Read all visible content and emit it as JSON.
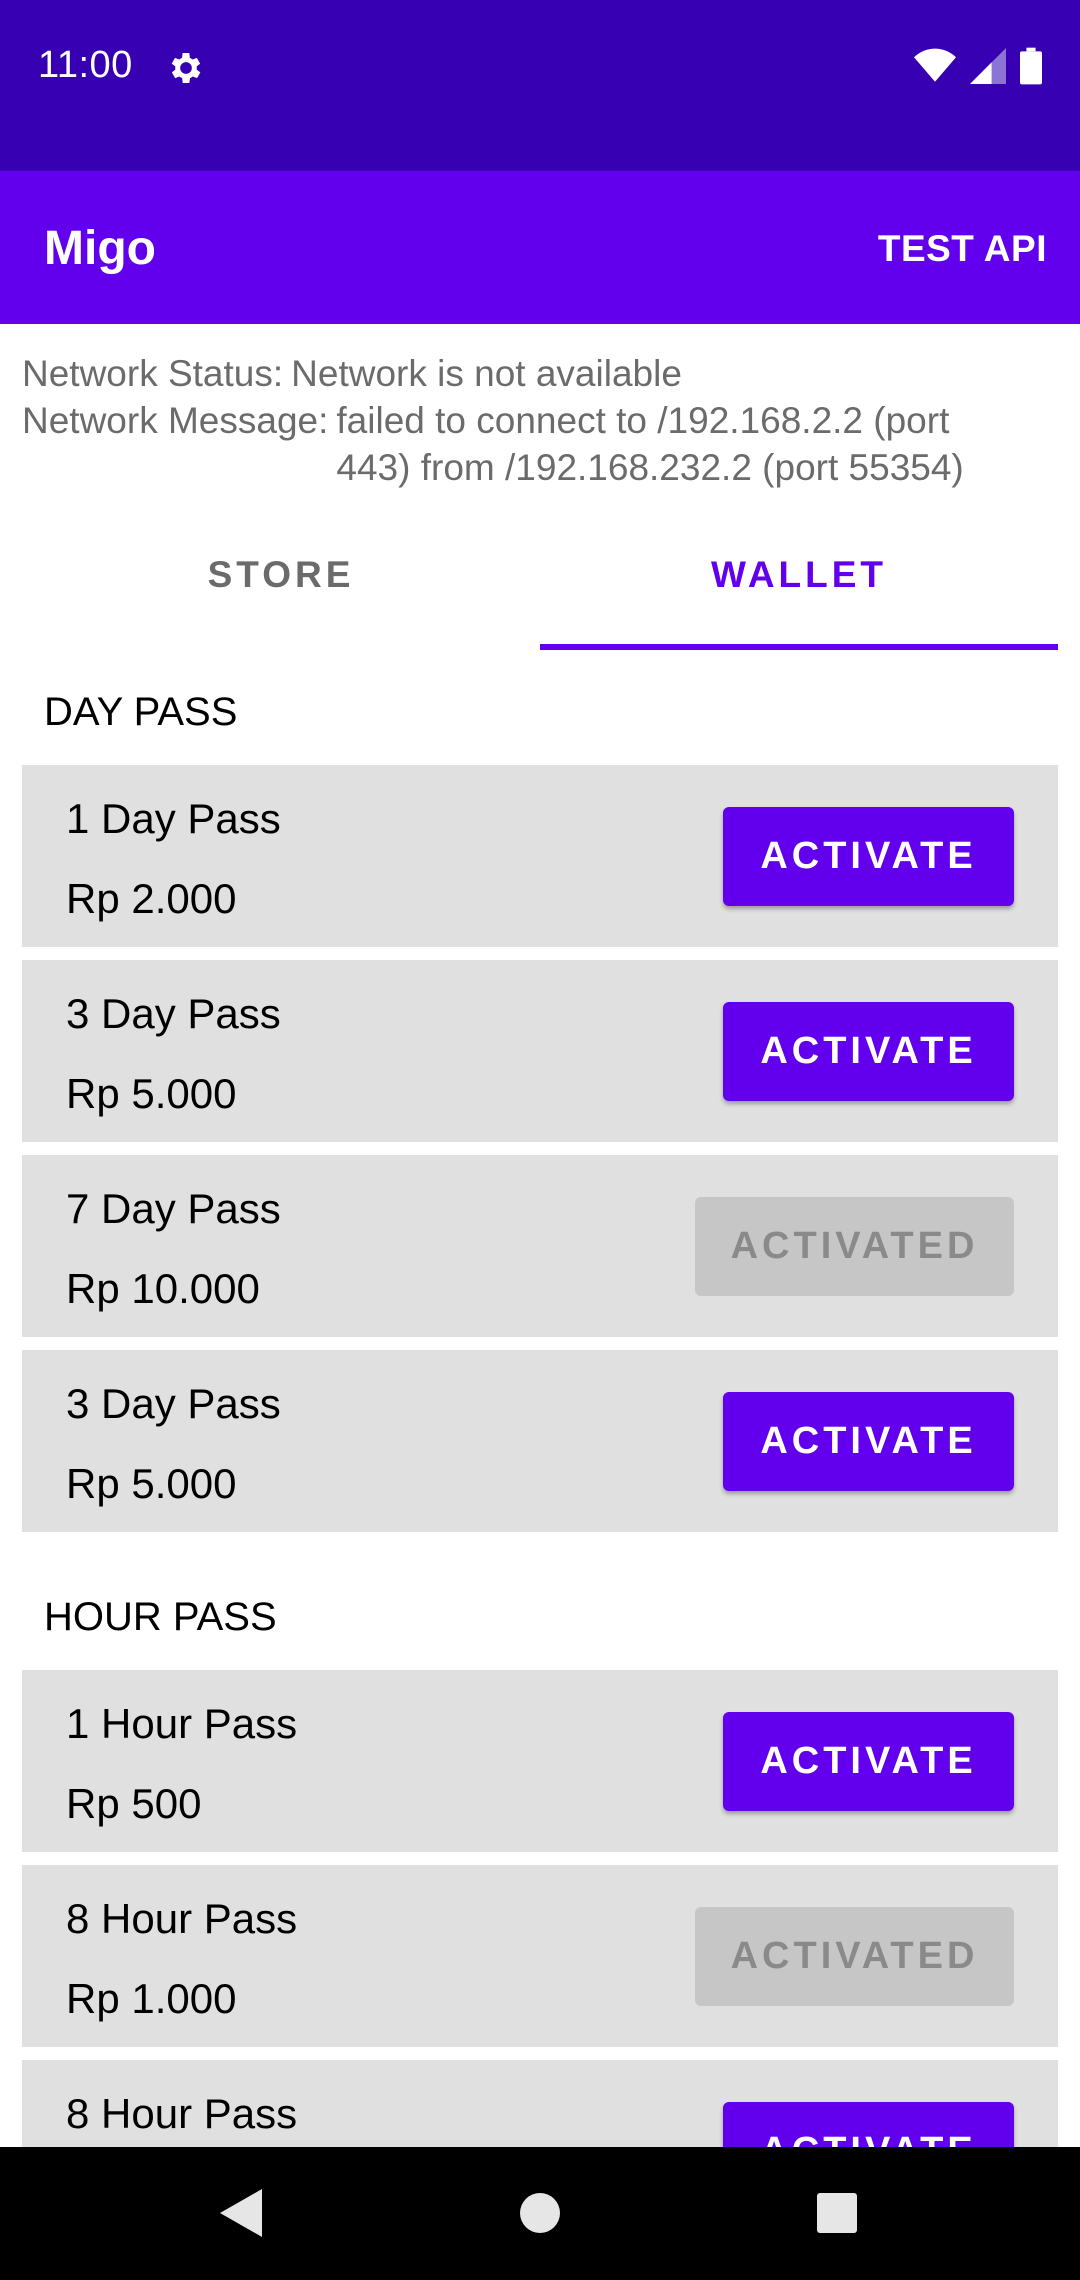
{
  "status_bar": {
    "time": "11:00",
    "icons": [
      "gear-icon",
      "wifi-icon",
      "signal-icon",
      "battery-icon"
    ]
  },
  "app_bar": {
    "title": "Migo",
    "action": "TEST API"
  },
  "network": {
    "status_label": "Network Status:",
    "status_value": "Network is not available",
    "message_label": "Network Message:",
    "message_value": "failed to connect to /192.168.2.2 (port 443) from /192.168.232.2 (port 55354)"
  },
  "tabs": {
    "store": "STORE",
    "wallet": "WALLET",
    "selected": "WALLET"
  },
  "sections": {
    "day_pass": {
      "title": "DAY PASS",
      "items": [
        {
          "name": "1 Day Pass",
          "price": "Rp 2.000",
          "button": "ACTIVATE"
        },
        {
          "name": "3 Day Pass",
          "price": "Rp 5.000",
          "button": "ACTIVATE"
        },
        {
          "name": "7 Day Pass",
          "price": "Rp 10.000",
          "button": "ACTIVATED"
        },
        {
          "name": "3 Day Pass",
          "price": "Rp 5.000",
          "button": "ACTIVATE"
        }
      ]
    },
    "hour_pass": {
      "title": "HOUR PASS",
      "items": [
        {
          "name": "1 Hour Pass",
          "price": "Rp 500",
          "button": "ACTIVATE"
        },
        {
          "name": "8 Hour Pass",
          "price": "Rp 1.000",
          "button": "ACTIVATED"
        },
        {
          "name": "8 Hour Pass",
          "price": "",
          "button": "ACTIVATE"
        }
      ]
    }
  },
  "colors": {
    "status_bar": "#3700b3",
    "primary": "#6200ee",
    "card": "#e0e0e0",
    "disabled_button": "#c6c6c6"
  }
}
